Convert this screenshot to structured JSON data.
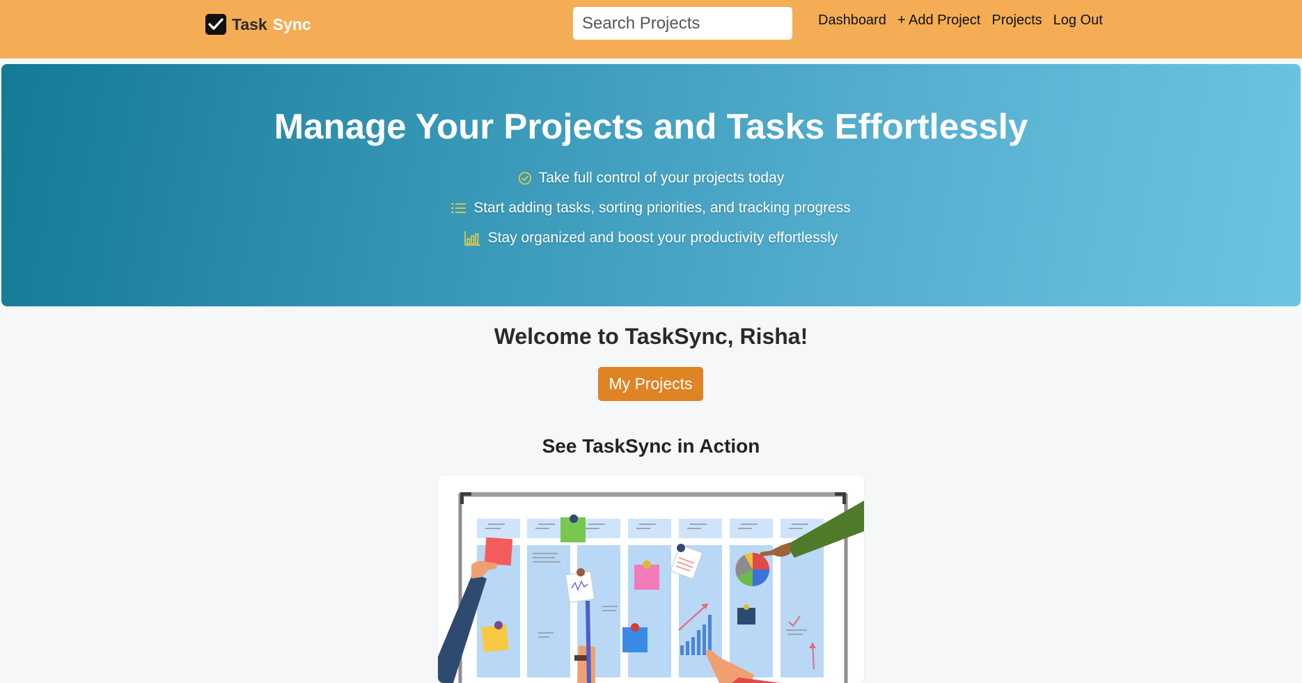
{
  "brand": {
    "task": "Task",
    "sync": "Sync",
    "icon": "checkbox-icon"
  },
  "search": {
    "placeholder": "Search Projects",
    "icon": "search-icon"
  },
  "nav": {
    "links": [
      "Dashboard",
      "+ Add Project",
      "Projects",
      "Log Out"
    ]
  },
  "hero": {
    "title": "Manage Your Projects and Tasks Effortlessly",
    "lines": [
      {
        "icon": "check-circle-icon",
        "text": "Take full control of your projects today"
      },
      {
        "icon": "list-icon",
        "text": "Start adding tasks, sorting priorities, and tracking progress"
      },
      {
        "icon": "bar-chart-icon",
        "text": "Stay organized and boost your productivity effortlessly"
      }
    ]
  },
  "main": {
    "welcome": "Welcome to TaskSync, Risha!",
    "my_projects_label": "My Projects",
    "section_title": "See TaskSync in Action"
  },
  "colors": {
    "navbar": "#f4ad55",
    "hero_start": "#147a95",
    "hero_end": "#6bc5e0",
    "button": "#de8424",
    "icon_accent": "#f2d23c"
  }
}
